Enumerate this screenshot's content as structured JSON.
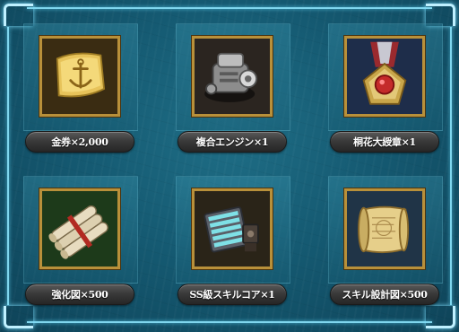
{
  "rewards": [
    {
      "label": "金券×2,000",
      "icon": "gold-ticket-icon",
      "bg": "#3a2c12"
    },
    {
      "label": "複合エンジン×1",
      "icon": "compound-engine-icon",
      "bg": "#2b2520"
    },
    {
      "label": "桐花大綬章×1",
      "icon": "paulownia-medal-icon",
      "bg": "#1e2d4a"
    },
    {
      "label": "強化図×500",
      "icon": "blueprint-scroll-icon",
      "bg": "#1d3a1a"
    },
    {
      "label": "SS級スキルコア×1",
      "icon": "skill-core-icon",
      "bg": "#2a2418"
    },
    {
      "label": "スキル設計図×500",
      "icon": "skill-design-scroll-icon",
      "bg": "#203447"
    }
  ],
  "colors": {
    "frame_accent": "#7fd6ee",
    "icon_border": "#b8903a",
    "label_plate": "#3a3a3a"
  }
}
